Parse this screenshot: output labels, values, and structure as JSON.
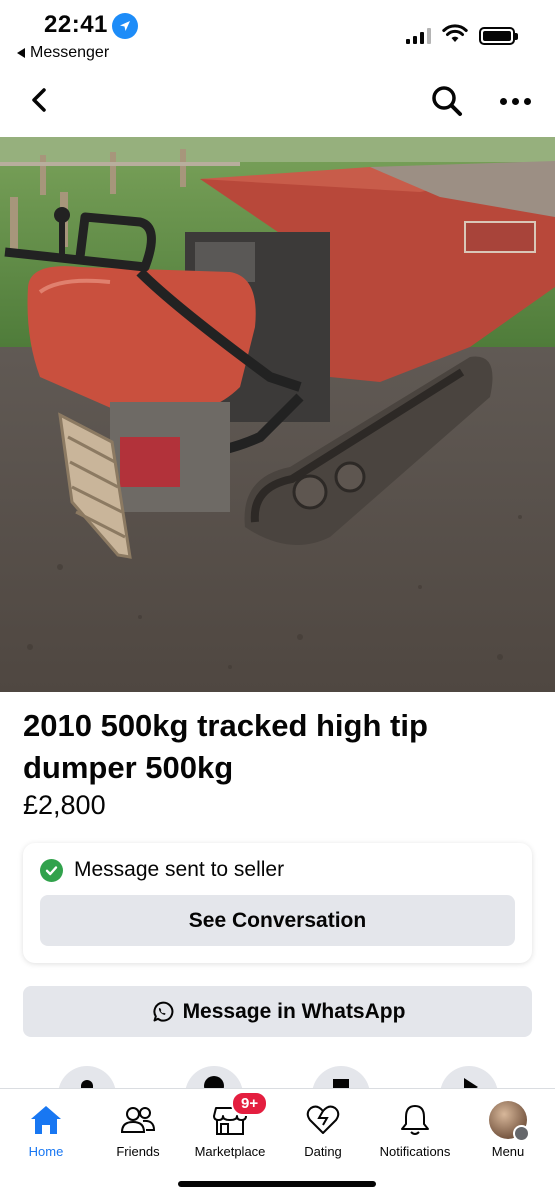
{
  "status_bar": {
    "time": "22:41",
    "back_app": "Messenger"
  },
  "listing": {
    "title": "2010 500kg tracked high tip dumper  500kg",
    "price": "£2,800",
    "photo_icon": "tracked-dumper-photo"
  },
  "message_card": {
    "status": "Message sent to seller",
    "button_label": "See Conversation"
  },
  "whatsapp": {
    "label": "Message in WhatsApp"
  },
  "tabs": [
    {
      "label": "Home",
      "icon": "home-icon",
      "active": true
    },
    {
      "label": "Friends",
      "icon": "friends-icon"
    },
    {
      "label": "Marketplace",
      "icon": "marketplace-icon",
      "badge": "9+"
    },
    {
      "label": "Dating",
      "icon": "dating-icon"
    },
    {
      "label": "Notifications",
      "icon": "bell-icon"
    },
    {
      "label": "Menu",
      "icon": "avatar"
    }
  ],
  "colors": {
    "accent": "#1877f2",
    "badge": "#e41e3f",
    "success": "#31a24c",
    "button_bg": "#e4e6eb"
  }
}
